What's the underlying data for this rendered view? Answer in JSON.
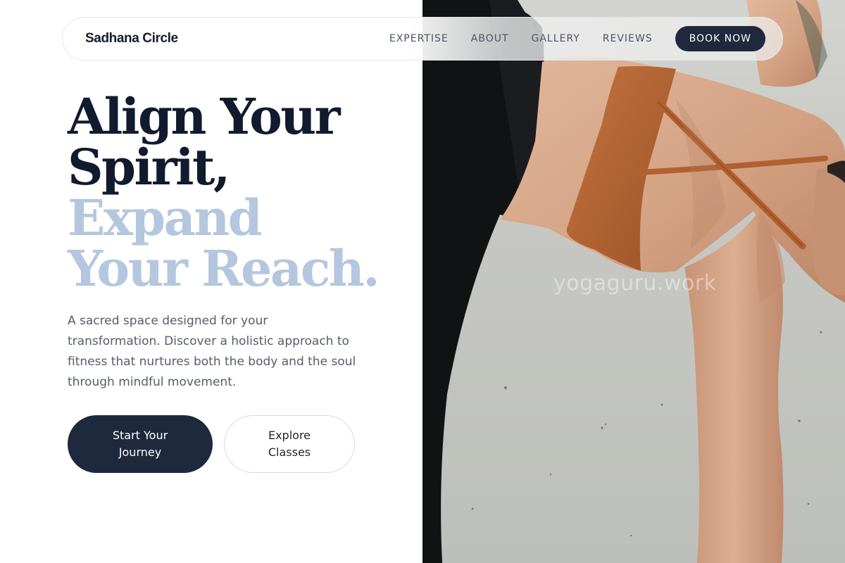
{
  "nav": {
    "brand": "Sadhana Circle",
    "links": [
      "EXPERTISE",
      "ABOUT",
      "GALLERY",
      "REVIEWS"
    ],
    "cta": "BOOK NOW"
  },
  "hero": {
    "headline_dark": [
      "Align Your",
      "Spirit,"
    ],
    "headline_light": [
      "Expand",
      "Your Reach."
    ],
    "description": "A sacred space designed for your transformation. Discover a holistic approach to fitness that nurtures both the body and the soul through mindful movement.",
    "primary_cta": "Start Your Journey",
    "secondary_cta": "Explore Classes"
  },
  "photo": {
    "subject": "yoga-pose-photo",
    "watermark": "yogaguru.work"
  },
  "colors": {
    "primary": "#1e293d",
    "heading_dark": "#111a2e",
    "heading_accent": "#b4c7de",
    "body_text": "#555d6c",
    "top_color": "#b9673a"
  }
}
